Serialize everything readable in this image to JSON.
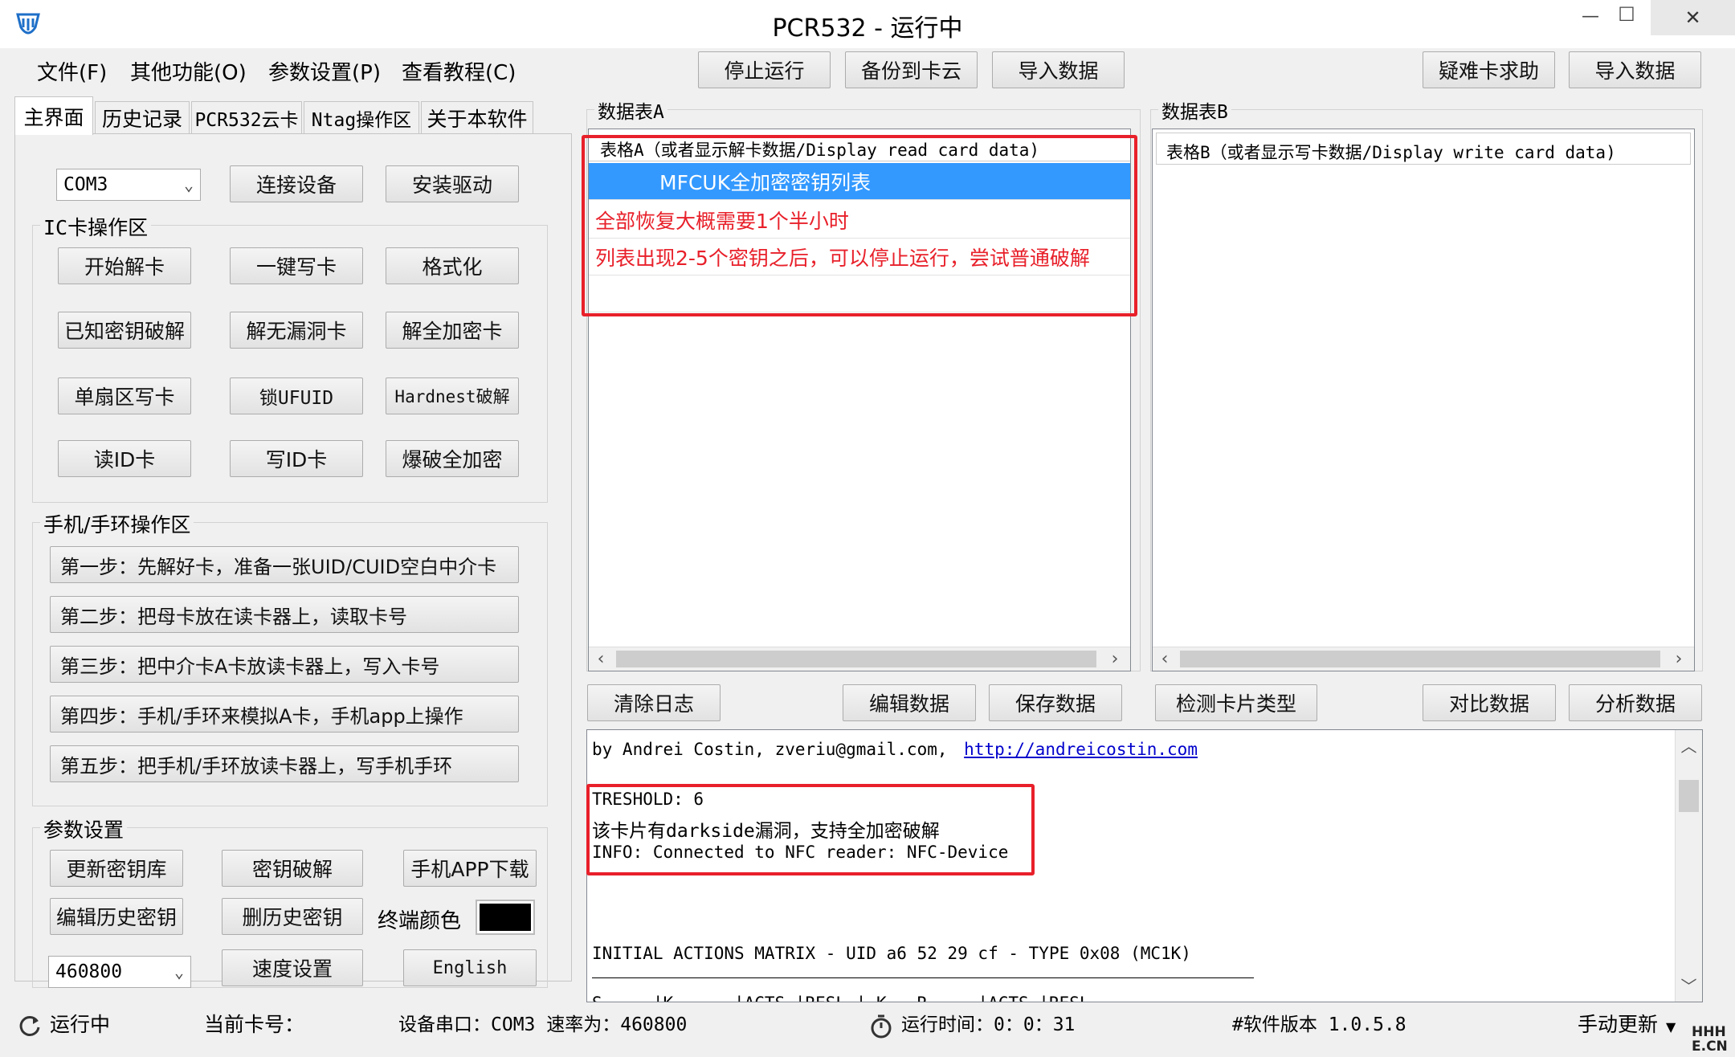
{
  "window": {
    "title": "PCR532 - 运行中",
    "minimize": "—",
    "maximize": "☐",
    "close": "✕"
  },
  "menu": [
    "文件(F)",
    "其他功能(O)",
    "参数设置(P)",
    "查看教程(C)"
  ],
  "toolbar": {
    "stop": "停止运行",
    "backup": "备份到卡云",
    "import1": "导入数据",
    "help": "疑难卡求助",
    "import2": "导入数据"
  },
  "tabs": [
    "主界面",
    "历史记录",
    "PCR532云卡",
    "Ntag操作区",
    "关于本软件"
  ],
  "device": {
    "port": "COM3",
    "connect": "连接设备",
    "driver": "安装驱动"
  },
  "ic": {
    "label": "IC卡操作区",
    "buttons": [
      "开始解卡",
      "一键写卡",
      "格式化",
      "已知密钥破解",
      "解无漏洞卡",
      "解全加密卡",
      "单扇区写卡",
      "锁UFUID",
      "Hardnest破解",
      "读ID卡",
      "写ID卡",
      "爆破全加密"
    ]
  },
  "phone": {
    "label": "手机/手环操作区",
    "steps": [
      "第一步：先解好卡，准备一张UID/CUID空白中介卡",
      "第二步：把母卡放在读卡器上，读取卡号",
      "第三步：把中介卡A卡放读卡器上，写入卡号",
      "第四步：手机/手环来模拟A卡，手机app上操作",
      "第五步：把手机/手环放读卡器上，写手机手环"
    ]
  },
  "params": {
    "label": "参数设置",
    "update_keys": "更新密钥库",
    "key_crack": "密钥破解",
    "app_download": "手机APP下载",
    "edit_history": "编辑历史密钥",
    "delete_history": "删历史密钥",
    "terminal_color": "终端颜色",
    "terminal_color_value": "#000000",
    "baud": "460800",
    "speed": "速度设置",
    "english": "English"
  },
  "tableA": {
    "label": "数据表A",
    "header": "表格A（或者显示解卡数据/Display read card data)",
    "rows": [
      "MFCUK全加密密钥列表",
      "全部恢复大概需要1个半小时",
      "列表出现2-5个密钥之后，可以停止运行，尝试普通破解"
    ]
  },
  "tableB": {
    "label": "数据表B",
    "header": "表格B（或者显示写卡数据/Display write card data)"
  },
  "actions": {
    "clear_log": "清除日志",
    "edit_data": "编辑数据",
    "save_data": "保存数据",
    "detect_card": "检测卡片类型",
    "compare": "对比数据",
    "analyze": "分析数据"
  },
  "log": {
    "author": "by Andrei Costin, zveriu@gmail.com,",
    "link": "http://andreicostin.com",
    "threshold": "TRESHOLD: 6",
    "darkside": "该卡片有darkside漏洞，支持全加密破解",
    "info": "INFO: Connected to NFC reader: NFC-Device",
    "matrix": "INITIAL ACTIONS MATRIX - UID a6 52 29 cf - TYPE 0x08 (MC1K)",
    "partial": "S____ |K_____ |ACTS |RESL |  K__ R____ |ACTS |RESL"
  },
  "status": {
    "running": "运行中",
    "current_card": "当前卡号：",
    "port_rate": "设备串口：COM3 速率为：460800",
    "runtime": "运行时间：0：0：31",
    "version": "#软件版本 1.0.5.8",
    "update": "手动更新"
  },
  "watermark": "HHH E.CN",
  "colors": {
    "selection": "#3399ff",
    "highlight_text": "#e8202a",
    "link": "#0000cc"
  }
}
